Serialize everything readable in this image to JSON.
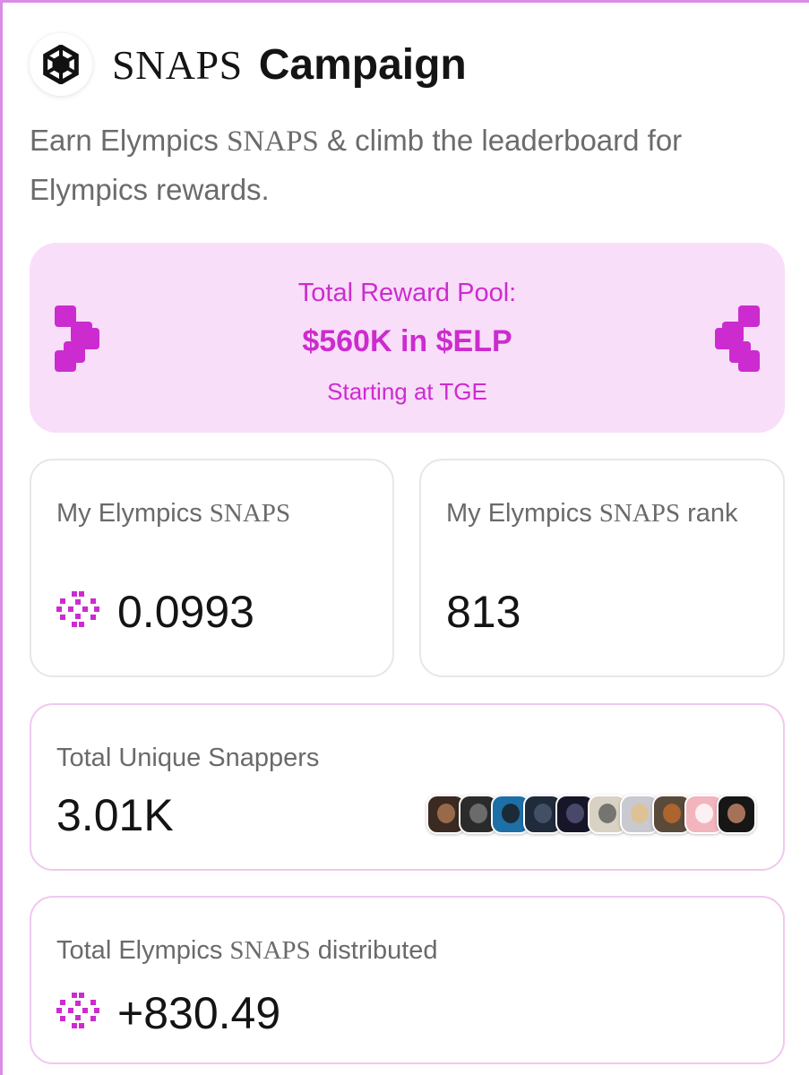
{
  "header": {
    "logo_icon": "elymphics-hexagon-logo-icon",
    "title_snaps": "SNAPS",
    "title_campaign": "Campaign"
  },
  "subtitle": {
    "part1": "Earn Elympics ",
    "snaps": "SNAPS",
    "part2": " & climb the leaderboard for Elympics rewards."
  },
  "reward_pool": {
    "label": "Total Reward Pool:",
    "amount": "$560K in $ELP",
    "start": "Starting at TGE",
    "accent_color": "#cc2ccf",
    "background_color": "#f8def8"
  },
  "my_snaps": {
    "label_part1": "My Elympics ",
    "label_snaps": "SNAPS",
    "value": "0.0993",
    "icon": "snap-dots-icon"
  },
  "my_rank": {
    "label_part1": "My Elympics ",
    "label_snaps": "SNAPS",
    "label_part2": " rank",
    "value": "813"
  },
  "unique_snappers": {
    "label": "Total Unique Snappers",
    "value": "3.01K",
    "avatars": [
      {
        "bg": "#3a2a22",
        "face": "#b07a55"
      },
      {
        "bg": "#2b2b2b",
        "face": "#7c7c7c"
      },
      {
        "bg": "#1d6fa8",
        "face": "#1a1a1a"
      },
      {
        "bg": "#1f2a3a",
        "face": "#4a5a70"
      },
      {
        "bg": "#161628",
        "face": "#55557a"
      },
      {
        "bg": "#d8d2c4",
        "face": "#5c5c5c"
      },
      {
        "bg": "#c9c9d0",
        "face": "#e2c08a"
      },
      {
        "bg": "#5a4a3a",
        "face": "#c26a2c"
      },
      {
        "bg": "#f2b5bd",
        "face": "#ffffff"
      },
      {
        "bg": "#161616",
        "face": "#c98a6a"
      }
    ]
  },
  "distributed": {
    "label_part1": "Total Elympics ",
    "label_snaps": "SNAPS",
    "label_part2": " distributed",
    "value": "+830.49",
    "icon": "snap-dots-icon"
  }
}
